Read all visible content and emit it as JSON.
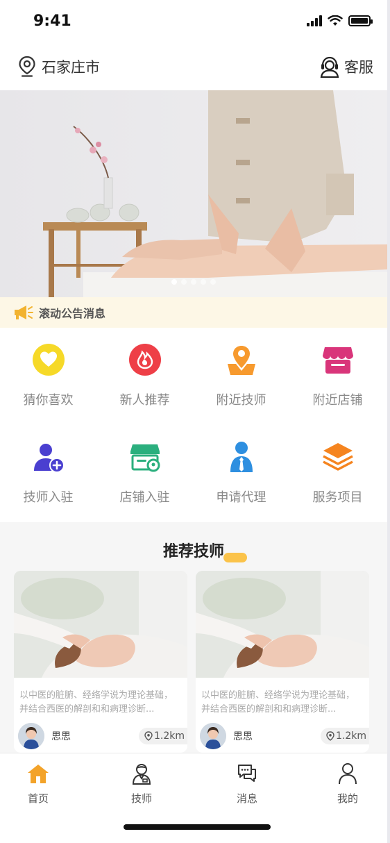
{
  "status_bar": {
    "time": "9:41"
  },
  "header": {
    "city": "石家庄市",
    "service_label": "客服"
  },
  "banner": {
    "slide_count": 5,
    "active_slide": 1
  },
  "notice": {
    "text": "滚动公告消息"
  },
  "grid": {
    "items": [
      {
        "label": "猜你喜欢",
        "icon": "heart-icon",
        "color": "#F6D928"
      },
      {
        "label": "新人推荐",
        "icon": "flame-icon",
        "color": "#EE3F47"
      },
      {
        "label": "附近技师",
        "icon": "map-pin-icon",
        "color": "#F79A2E"
      },
      {
        "label": "附近店铺",
        "icon": "store-icon",
        "color": "#D9357A"
      },
      {
        "label": "技师入驻",
        "icon": "user-add-icon",
        "color": "#4A3FD0"
      },
      {
        "label": "店铺入驻",
        "icon": "shop-location-icon",
        "color": "#2BAF7E"
      },
      {
        "label": "申请代理",
        "icon": "agent-tie-icon",
        "color": "#2E8FE0"
      },
      {
        "label": "服务项目",
        "icon": "layers-icon",
        "color": "#F5841F"
      }
    ]
  },
  "recommend": {
    "title": "推荐技师",
    "cards": [
      {
        "desc_line1": "以中医的脏腑、经络学说为理论基础，",
        "desc_line2": "并结合西医的解剖和和病理诊断...",
        "name": "思思",
        "distance": "1.2km"
      },
      {
        "desc_line1": "以中医的脏腑、经络学说为理论基础，",
        "desc_line2": "并结合西医的解剖和和病理诊断...",
        "name": "思思",
        "distance": "1.2km"
      }
    ]
  },
  "tabbar": {
    "active_color": "#F3A32A",
    "items": [
      {
        "label": "首页",
        "icon": "home-icon"
      },
      {
        "label": "技师",
        "icon": "technician-icon"
      },
      {
        "label": "消息",
        "icon": "message-icon"
      },
      {
        "label": "我的",
        "icon": "profile-icon"
      }
    ]
  }
}
